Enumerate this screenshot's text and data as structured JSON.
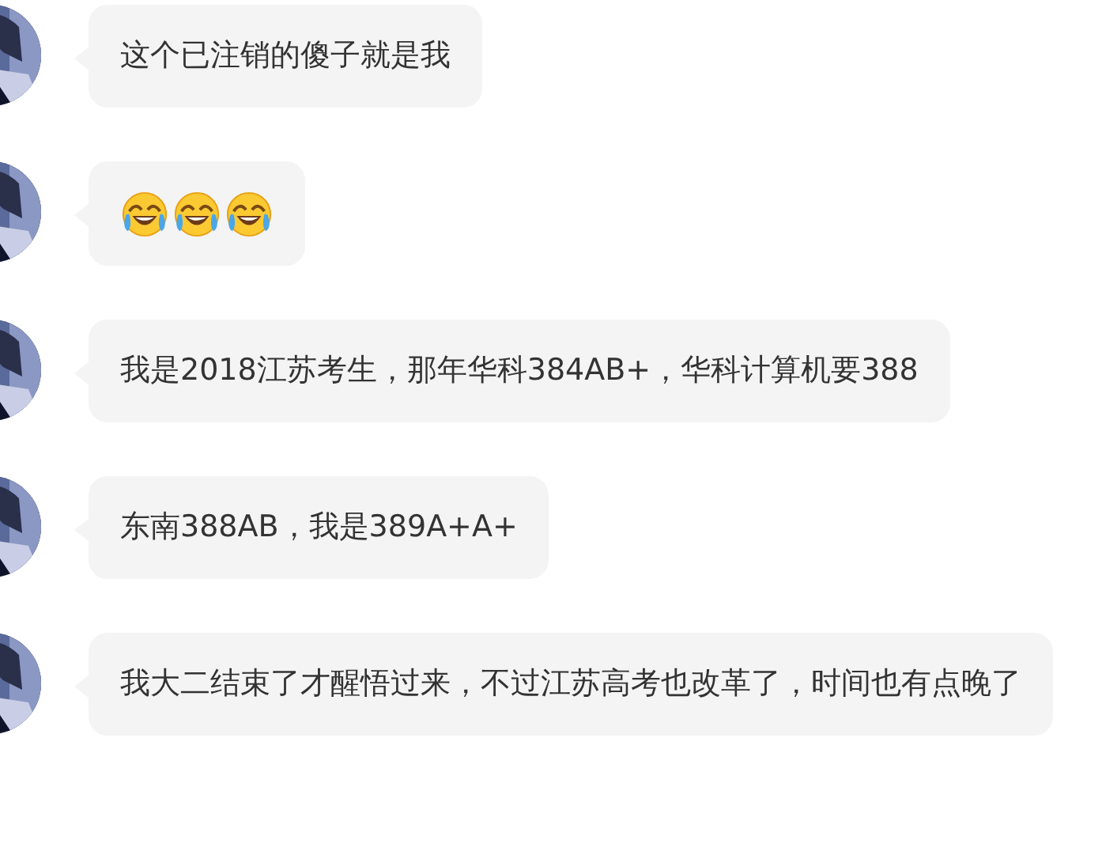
{
  "messages": [
    {
      "kind": "text",
      "text": "这个已注销的傻子就是我"
    },
    {
      "kind": "emoji",
      "emojis": [
        {
          "kind": "laughing-crying"
        },
        {
          "kind": "laughing-crying"
        },
        {
          "kind": "laughing-crying"
        }
      ]
    },
    {
      "kind": "text",
      "text": "我是2018江苏考生，那年华科384AB+，华科计算机要388"
    },
    {
      "kind": "text",
      "text": "东南388AB，我是389A+A+"
    },
    {
      "kind": "text",
      "text": "我大二结束了才醒悟过来，不过江苏高考也改革了，时间也有点晚了"
    }
  ]
}
